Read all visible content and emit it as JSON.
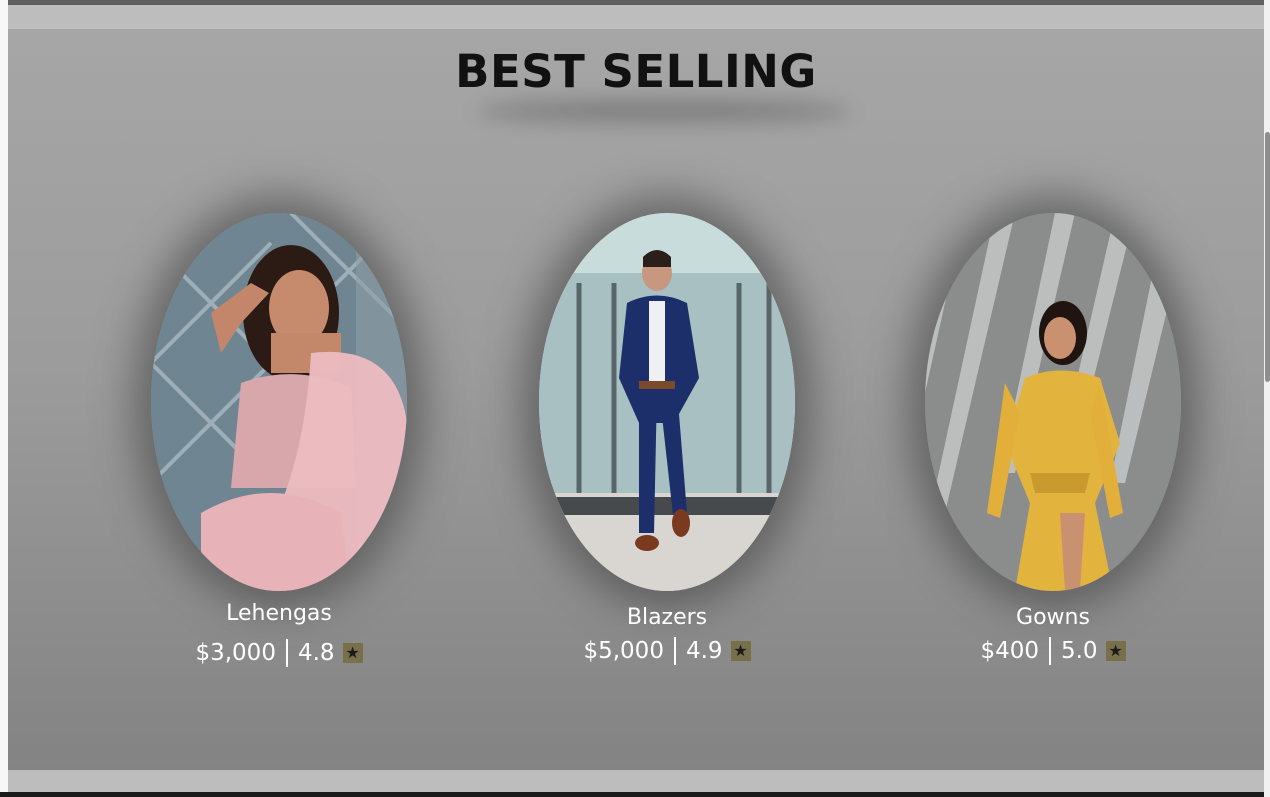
{
  "section": {
    "title": "BEST SELLING"
  },
  "products": [
    {
      "name": "Lehengas",
      "price": "$3,000",
      "rating": "4.8",
      "icon": "star-icon",
      "image": "woman-in-pink-lehenga-photo"
    },
    {
      "name": "Blazers",
      "price": "$5,000",
      "rating": "4.9",
      "icon": "star-icon",
      "image": "man-in-navy-suit-photo"
    },
    {
      "name": "Gowns",
      "price": "$400",
      "rating": "5.0",
      "icon": "star-icon",
      "image": "woman-in-yellow-dress-photo"
    }
  ],
  "colors": {
    "title": "#111111",
    "text": "#ffffff",
    "star_badge": "#77704a",
    "section_bg": "#a0a0a0"
  }
}
